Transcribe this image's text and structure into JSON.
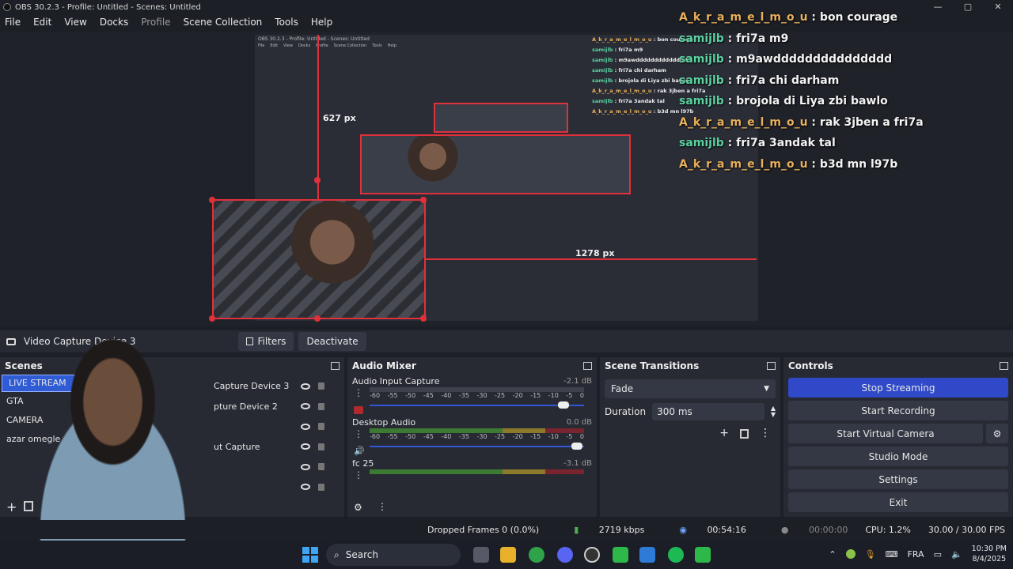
{
  "window": {
    "title": "OBS 30.2.3 - Profile: Untitled - Scenes: Untitled",
    "controls": {
      "minimize": "—",
      "maximize": "▢",
      "close": "✕"
    }
  },
  "menu": [
    "File",
    "Edit",
    "View",
    "Docks",
    "Profile",
    "Scene Collection",
    "Tools",
    "Help"
  ],
  "preview": {
    "measure_v": "627 px",
    "measure_h": "1278 px",
    "nested_title": "OBS 30.2.3 - Profile: Untitled - Scenes: Untitled"
  },
  "chat": [
    {
      "user": "A_k_r_a_m_e_l_m_o_u",
      "msg": "bon courage",
      "color": "orange"
    },
    {
      "user": "samijlb",
      "msg": "fri7a m9",
      "color": "green"
    },
    {
      "user": "samijlb",
      "msg": "m9awddddddddddddddd",
      "color": "green"
    },
    {
      "user": "samijlb",
      "msg": "fri7a chi darham",
      "color": "green"
    },
    {
      "user": "samijlb",
      "msg": "brojola di Liya zbi bawlo",
      "color": "green"
    },
    {
      "user": "A_k_r_a_m_e_l_m_o_u",
      "msg": "rak 3jben a fri7a",
      "color": "orange"
    },
    {
      "user": "samijlb",
      "msg": "fri7a 3andak tal",
      "color": "green"
    },
    {
      "user": "A_k_r_a_m_e_l_m_o_u",
      "msg": "b3d mn l97b",
      "color": "orange"
    }
  ],
  "source_toolbar": {
    "source_name": "Video Capture Device 3",
    "filters_label": "Filters",
    "deactivate_label": "Deactivate"
  },
  "scenes": {
    "title": "Scenes",
    "items": [
      "LIVE STREAM",
      "GTA",
      "CAMERA",
      "azar omegle"
    ],
    "selected": "LIVE STREAM"
  },
  "sources": {
    "items": [
      "Capture Device 3",
      "pture Device 2",
      "",
      "ut Capture",
      "",
      ""
    ]
  },
  "audio_mixer": {
    "title": "Audio Mixer",
    "scale": [
      "-60",
      "-55",
      "-50",
      "-45",
      "-40",
      "-35",
      "-30",
      "-25",
      "-20",
      "-15",
      "-10",
      "-5",
      "0"
    ],
    "channels": [
      {
        "name": "Audio Input Capture",
        "db": "-2.1 dB",
        "level": 0.0,
        "volume": 0.9,
        "muted": true
      },
      {
        "name": "Desktop Audio",
        "db": "0.0 dB",
        "level": 1.0,
        "volume": 1.0,
        "muted": false
      },
      {
        "name": "fc 25",
        "db": "-3.1 dB",
        "level": 1.0,
        "volume": 1.0,
        "muted": false
      }
    ]
  },
  "scene_transitions": {
    "title": "Scene Transitions",
    "transition": "Fade",
    "duration_label": "Duration",
    "duration_value": "300 ms"
  },
  "controls": {
    "title": "Controls",
    "stop_streaming": "Stop Streaming",
    "start_recording": "Start Recording",
    "start_virtual_camera": "Start Virtual Camera",
    "studio_mode": "Studio Mode",
    "settings": "Settings",
    "exit": "Exit"
  },
  "status": {
    "dropped_frames": "Dropped Frames 0 (0.0%)",
    "bitrate": "2719 kbps",
    "stream_time": "00:54:16",
    "rec_time": "00:00:00",
    "cpu": "CPU: 1.2%",
    "fps": "30.00 / 30.00 FPS"
  },
  "taskbar": {
    "search_placeholder": "Search",
    "lang": "FRA",
    "time": "10:30 PM",
    "date": "8/4/2025"
  },
  "colors": {
    "accent": "#2f49c8",
    "selection": "#2f5bd4",
    "measure_red": "#e0303a",
    "chat_orange": "#e8b05a",
    "chat_green": "#5bd0a0"
  }
}
